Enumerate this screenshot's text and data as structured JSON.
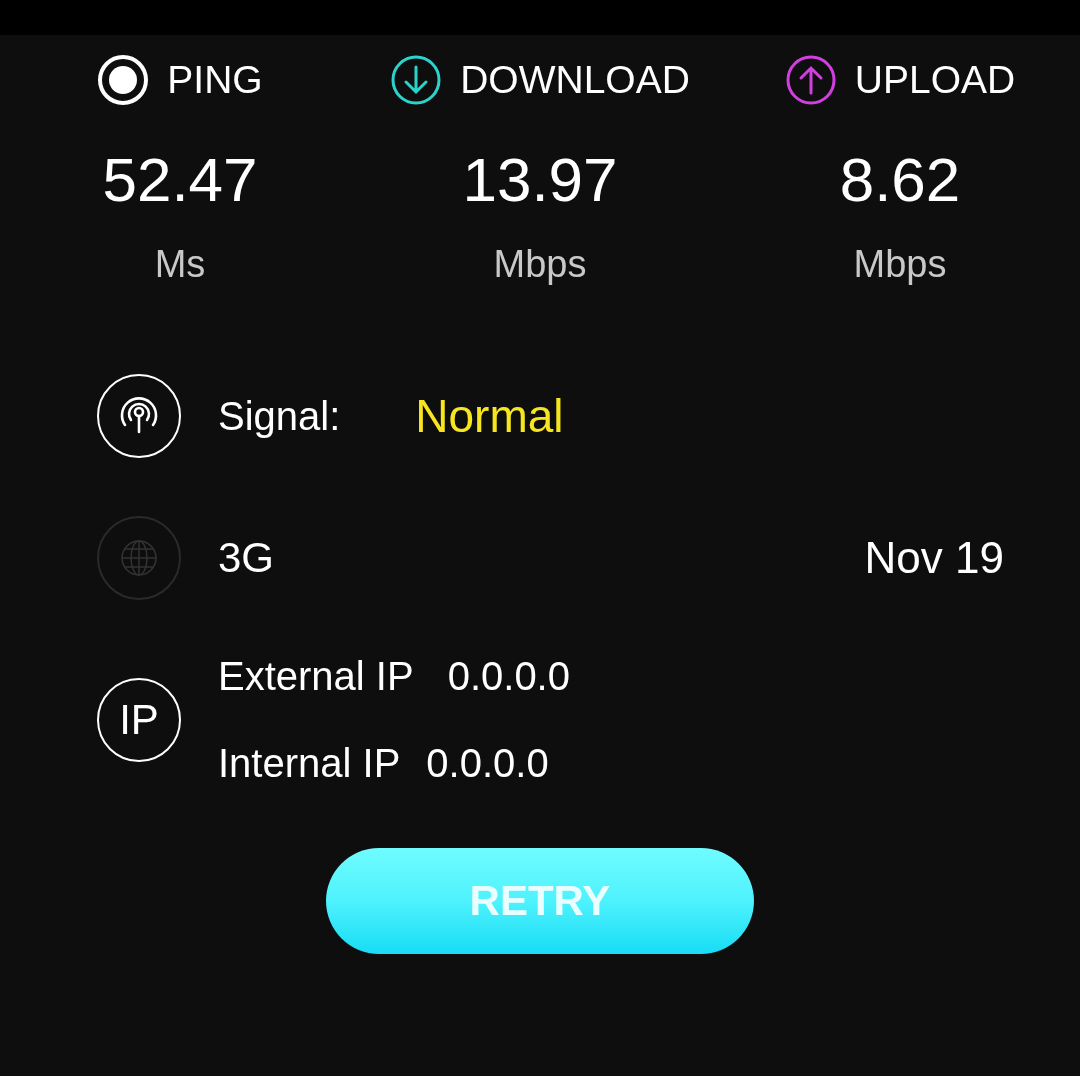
{
  "metrics": [
    {
      "kind": "ping",
      "label": "PING",
      "value": "52.47",
      "unit": "Ms"
    },
    {
      "kind": "download",
      "label": "DOWNLOAD",
      "value": "13.97",
      "unit": "Mbps"
    },
    {
      "kind": "upload",
      "label": "UPLOAD",
      "value": "8.62",
      "unit": "Mbps"
    }
  ],
  "signal": {
    "label": "Signal:",
    "value": "Normal"
  },
  "network": {
    "type": "3G",
    "date": "Nov 19"
  },
  "ip": {
    "icon_text": "IP",
    "rows": [
      {
        "label": "External IP",
        "value": "0.0.0.0"
      },
      {
        "label": "Internal IP",
        "value": "0.0.0.0"
      }
    ]
  },
  "button": "RETRY"
}
